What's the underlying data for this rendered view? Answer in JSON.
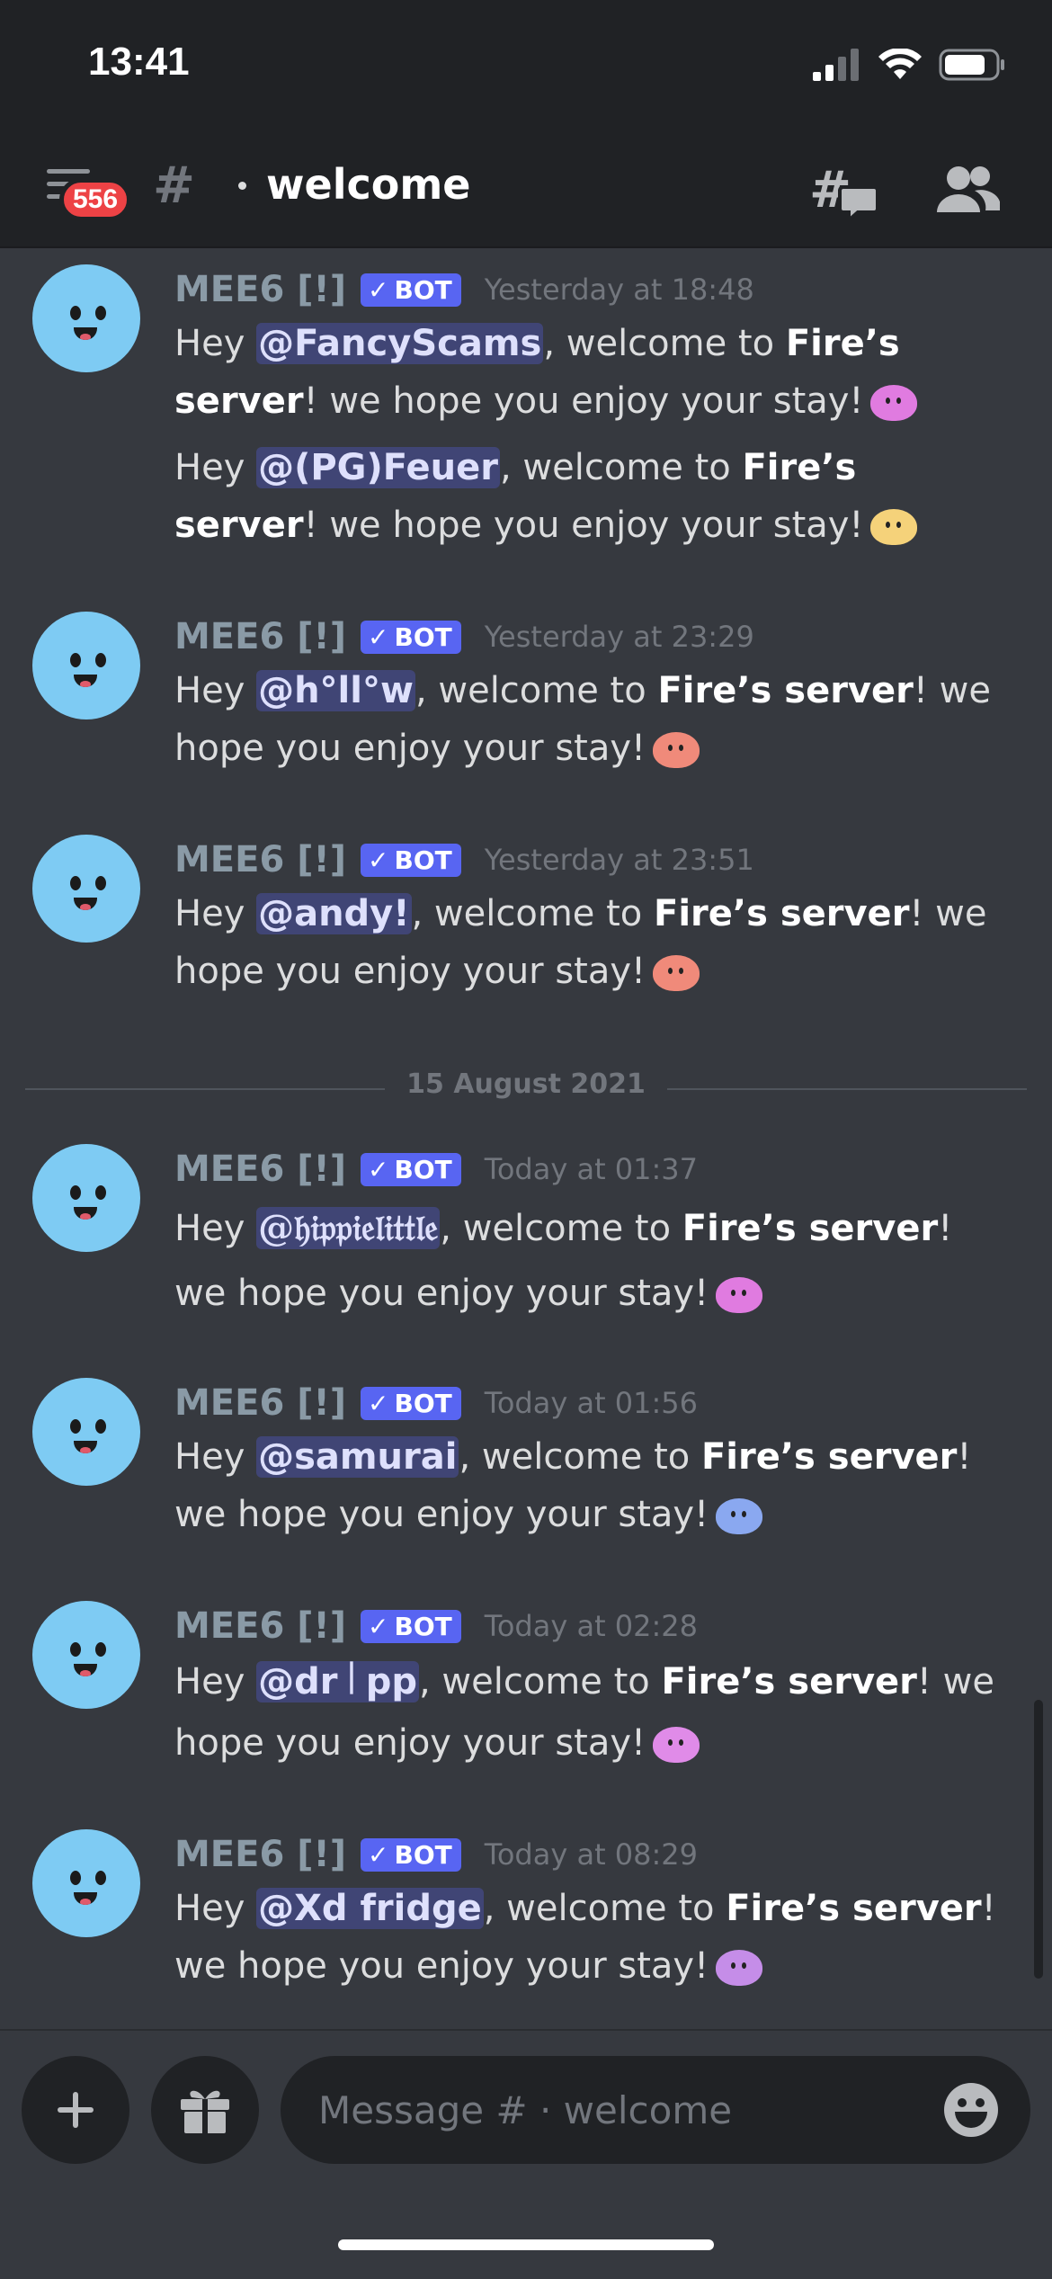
{
  "status_bar": {
    "time": "13:41"
  },
  "header": {
    "badge_count": "556",
    "hash_symbol": "#",
    "channel_name": "welcome"
  },
  "messages": [
    {
      "author": "MEE6 [!]",
      "bot_label": "BOT",
      "timestamp": "Yesterday at 18:48",
      "lines": [
        {
          "pre": "Hey ",
          "mention": "@FancyScams",
          "mid": ", welcome to ",
          "server": "Fire’s server",
          "post": "! we hope you enjoy your stay!",
          "emoji_color": "#e07be0"
        },
        {
          "pre": "Hey ",
          "mention": "@(PG)Feuer",
          "mid": ", welcome to ",
          "server": "Fire’s server",
          "post": "! we hope you enjoy your stay!",
          "emoji_color": "#f5d27a"
        }
      ]
    },
    {
      "author": "MEE6 [!]",
      "bot_label": "BOT",
      "timestamp": "Yesterday at 23:29",
      "lines": [
        {
          "pre": "Hey ",
          "mention": "@h°ll°w",
          "mid": ", welcome to ",
          "server": "Fire’s server",
          "post": "! we hope you enjoy your stay!",
          "emoji_color": "#f08a7a"
        }
      ]
    },
    {
      "author": "MEE6 [!]",
      "bot_label": "BOT",
      "timestamp": "Yesterday at 23:51",
      "lines": [
        {
          "pre": "Hey ",
          "mention": "@andy!",
          "mid": ", welcome to ",
          "server": "Fire’s server",
          "post": "! we hope you enjoy your stay!",
          "emoji_color": "#f08a7a"
        }
      ]
    },
    {
      "author": "MEE6 [!]",
      "bot_label": "BOT",
      "timestamp": "Today at 01:37",
      "lines": [
        {
          "pre": "Hey ",
          "mention": "@𝔥𝔦𝔭𝔭𝔦𝔢𝔩𝔦𝔱𝔱𝔩𝔢",
          "mid": ", welcome to ",
          "server": "Fire’s server",
          "post": "! we hope you enjoy your stay!",
          "emoji_color": "#e07be0"
        }
      ]
    },
    {
      "author": "MEE6 [!]",
      "bot_label": "BOT",
      "timestamp": "Today at 01:56",
      "lines": [
        {
          "pre": "Hey ",
          "mention": "@samurai",
          "mid": ", welcome to ",
          "server": "Fire’s server",
          "post": "! we hope you enjoy your stay!",
          "emoji_color": "#8aa8f0"
        }
      ]
    },
    {
      "author": "MEE6 [!]",
      "bot_label": "BOT",
      "timestamp": "Today at 02:28",
      "lines": [
        {
          "pre": "Hey ",
          "mention": "@dr꒐pp",
          "mid": ", welcome to ",
          "server": "Fire’s server",
          "post": "! we hope you enjoy your stay!",
          "emoji_color": "#e08be8"
        }
      ]
    },
    {
      "author": "MEE6 [!]",
      "bot_label": "BOT",
      "timestamp": "Today at 08:29",
      "lines": [
        {
          "pre": "Hey ",
          "mention": "@Xd fridge",
          "mid": ", welcome to ",
          "server": "Fire’s server",
          "post": "! we hope you enjoy your stay!",
          "emoji_color": "#c58de8"
        }
      ]
    }
  ],
  "date_divider": "15 August 2021",
  "composer": {
    "placeholder": "Message # · welcome"
  }
}
